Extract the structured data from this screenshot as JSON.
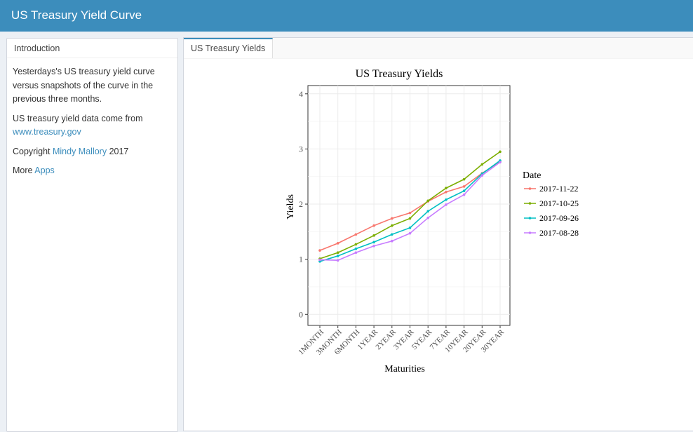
{
  "header": {
    "title": "US Treasury Yield Curve"
  },
  "sidebar": {
    "heading": "Introduction",
    "intro": "Yesterdays's US treasury yield curve versus snapshots of the curve in the previous three months.",
    "source_prefix": "US treasury yield data come from",
    "source_link": "www.treasury.gov",
    "copyright_prefix": "Copyright",
    "copyright_name": "Mindy Mallory",
    "copyright_year": "2017",
    "more_prefix": "More",
    "more_link": "Apps"
  },
  "tabs": [
    {
      "label": "US Treasury Yields",
      "active": true
    }
  ],
  "chart_data": {
    "type": "line",
    "title": "US Treasury Yields",
    "xlabel": "Maturities",
    "ylabel": "Yields",
    "categories": [
      "1MONTH",
      "3MONTH",
      "6MONTH",
      "1YEAR",
      "2YEAR",
      "3YEAR",
      "5YEAR",
      "7YEAR",
      "10YEAR",
      "20YEAR",
      "30YEAR"
    ],
    "ylim": [
      -0.2,
      4.15
    ],
    "yticks": [
      0,
      1,
      2,
      3,
      4
    ],
    "grid": true,
    "legend_title": "Date",
    "legend_position": "right",
    "series": [
      {
        "name": "2017-11-22",
        "color": "#f8766d",
        "values": [
          1.16,
          1.29,
          1.45,
          1.61,
          1.74,
          1.84,
          2.05,
          2.22,
          2.32,
          2.56,
          2.77
        ]
      },
      {
        "name": "2017-10-25",
        "color": "#7cae00",
        "values": [
          1.01,
          1.12,
          1.27,
          1.43,
          1.61,
          1.74,
          2.06,
          2.29,
          2.45,
          2.72,
          2.95
        ]
      },
      {
        "name": "2017-09-26",
        "color": "#00bfc4",
        "values": [
          0.96,
          1.06,
          1.19,
          1.31,
          1.45,
          1.57,
          1.87,
          2.08,
          2.24,
          2.55,
          2.79
        ]
      },
      {
        "name": "2017-08-28",
        "color": "#c77cff",
        "values": [
          0.99,
          0.98,
          1.12,
          1.24,
          1.33,
          1.47,
          1.75,
          1.99,
          2.17,
          2.52,
          2.76
        ]
      }
    ]
  }
}
